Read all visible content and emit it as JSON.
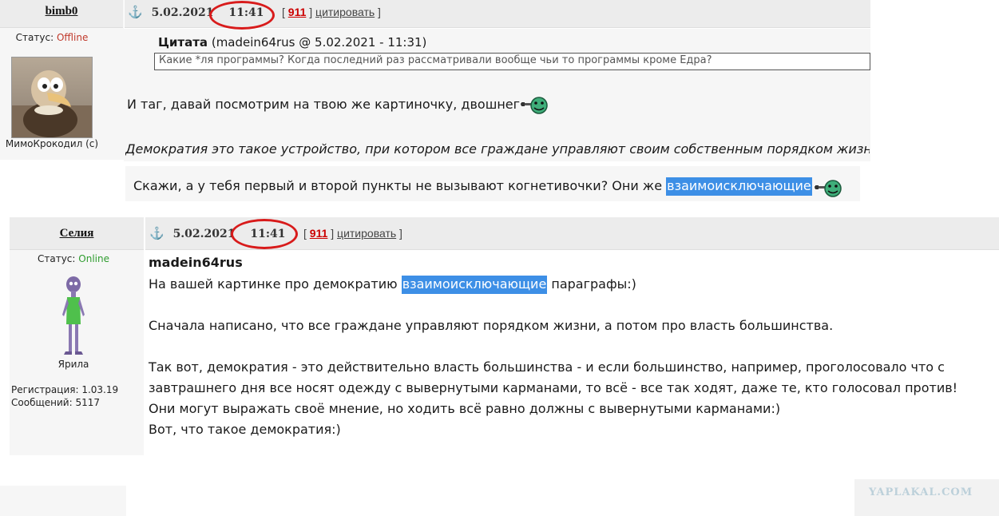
{
  "posts": [
    {
      "author": "bimb0",
      "status_label": "Статус:",
      "status_value": "Offline",
      "signature": "МимоКрокодил (с)",
      "date": "5.02.2021",
      "time": "11:41",
      "count": "911",
      "quote_action": "цитировать",
      "quote": {
        "label": "Цитата",
        "meta": "(madein64rus @ 5.02.2021 - 11:31)",
        "text": "Какие *ля программы? Когда последний раз рассматривали вообще чьи то программы кроме Едра?"
      },
      "line1": "И таг, давай посмотрим на твою же картиночку, двошнег",
      "line2": "Демократия это такое устройство, при котором все граждане управляют своим собственным порядком жизни",
      "line3_before": "Скажи, а у тебя первый и второй пункты не вызывают когнетивочки? Они же ",
      "line3_highlight": "взаимоисключающие"
    },
    {
      "author": "Селия",
      "status_label": "Статус:",
      "status_value": "Online",
      "avatar_caption": "Ярила",
      "reg": "Регистрация: 1.03.19",
      "messages": "Сообщений: 5117",
      "date": "5.02.2021",
      "time": "11:41",
      "count": "911",
      "quote_action": "цитировать",
      "reply_to": "madein64rus",
      "line1_before": "На вашей картинке про демократию ",
      "line1_highlight": "взаимоисключающие",
      "line1_after": " параграфы:)",
      "line2": "Сначала написано, что все граждане управляют порядком жизни, а потом про власть большинства.",
      "line3": "Так вот, демократия - это действительно власть большинства - и если большинство, например, проголосовало что с",
      "line4": "завтрашнего дня все носят одежду с вывернутыми карманами, то всё - все так ходят, даже те, кто голосовал против!",
      "line5": "Они могут выражать своё мнение, но ходить всё равно должны с вывернутыми карманами:)",
      "line6": "Вот, что такое демократия:)"
    }
  ],
  "brackets": {
    "open": "[",
    "close": "]"
  },
  "watermark": "YAPLAKAL.COM",
  "colors": {
    "highlight": "#3d8fe6",
    "offline": "#c0392b",
    "online": "#2e9c2e",
    "count": "#cc0000",
    "ring": "#d81b1b"
  }
}
